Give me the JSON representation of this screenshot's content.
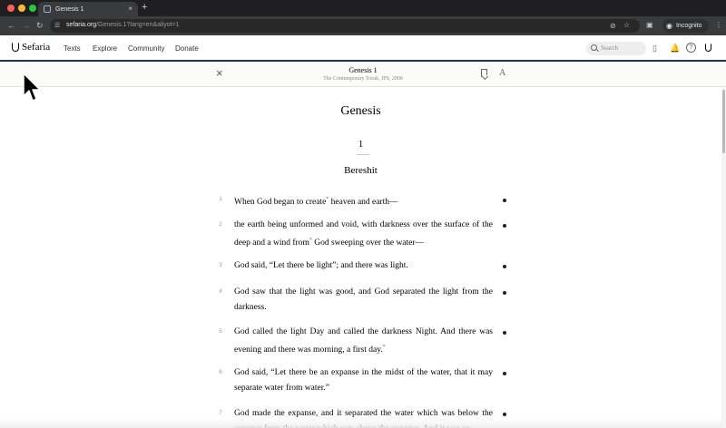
{
  "browser": {
    "tab_title": "Genesis 1",
    "tab_close": "×",
    "new_tab": "+",
    "url_host": "sefaria.org",
    "url_path": "/Genesis.1?lang=en&aliyot=1",
    "incognito_label": "Incognito",
    "icons": [
      "back-arrow",
      "forward-arrow",
      "reload",
      "site-info",
      "eye-off",
      "star",
      "sidebar",
      "profile",
      "menu-dots"
    ]
  },
  "site": {
    "logo": "Sefaria",
    "nav": [
      "Texts",
      "Explore",
      "Community",
      "Donate"
    ],
    "search_placeholder": "Search",
    "accent_color": "#18345d"
  },
  "reader_bar": {
    "close": "×",
    "title": "Genesis 1",
    "subtitle": "The Contemporary Torah, JPS, 2006",
    "font_label": "A"
  },
  "text": {
    "book": "Genesis",
    "chapter": "1",
    "parasha": "Bereshit",
    "verses": [
      {
        "num": "1",
        "text": "When God began to create",
        "note": "*",
        "text_after": " heaven and earth—"
      },
      {
        "num": "2",
        "text": "the earth being unformed and void, with darkness over the surface of the deep and a wind from",
        "note": "*",
        "text_after": " God sweeping over the water—"
      },
      {
        "num": "3",
        "text": "God said, “Let there be light”; and there was light.",
        "note": "",
        "text_after": ""
      },
      {
        "num": "4",
        "text": "God saw that the light was good, and God separated the light from the darkness.",
        "note": "",
        "text_after": ""
      },
      {
        "num": "5",
        "text": "God called the light Day and called the darkness Night. And there was evening and there was morning, a first day.",
        "note": "*",
        "text_after": ""
      },
      {
        "num": "6",
        "text": "God said, “Let there be an expanse in the midst of the water, that it may separate water from water.”",
        "note": "",
        "text_after": ""
      },
      {
        "num": "7",
        "text": "God made the expanse, and it separated the water which was below the expanse from the water which was above the expanse. And it was so.",
        "note": "",
        "text_after": ""
      }
    ]
  }
}
